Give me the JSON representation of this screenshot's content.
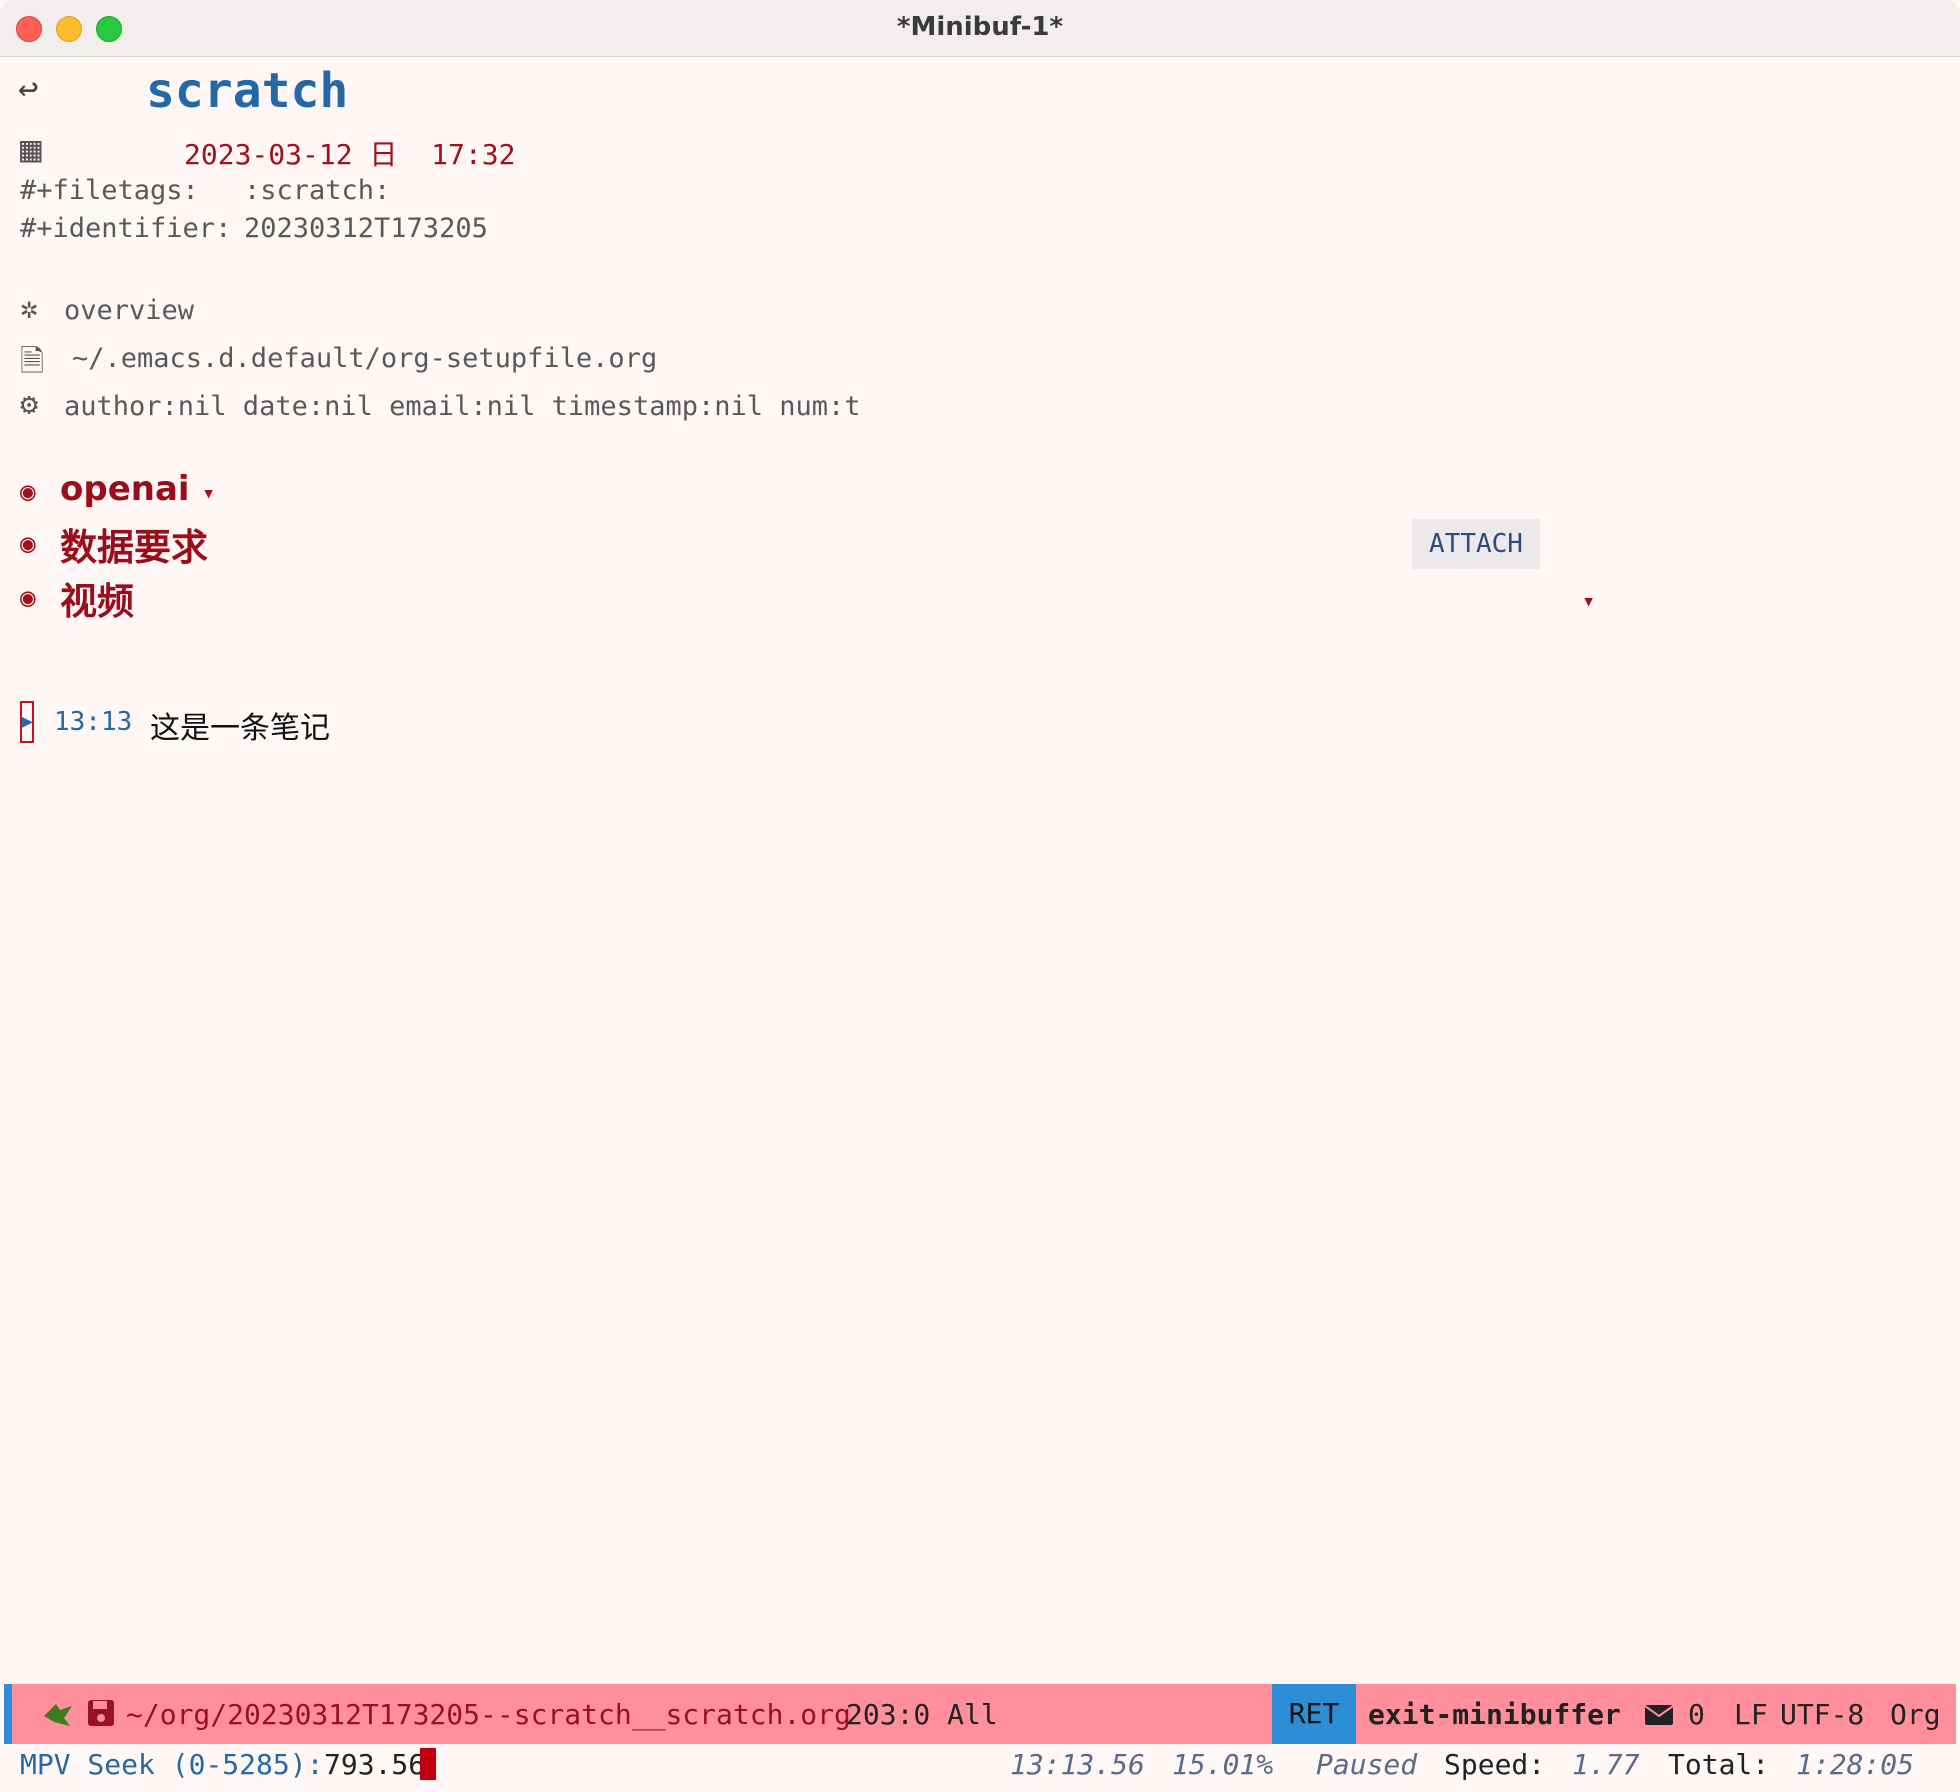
{
  "window": {
    "title": "*Minibuf-1*"
  },
  "buffer": {
    "title_icon": "↩",
    "title": "scratch",
    "calendar_icon": "▦",
    "date": "2023-03-12 日  17:32",
    "filetags_key": "#+filetags:",
    "filetags_value": ":scratch:",
    "identifier_key": "#+identifier:",
    "identifier_value": "20230312T173205",
    "meta": [
      {
        "icon": "✲",
        "text": "overview"
      },
      {
        "icon": "🗎",
        "text": "~/.emacs.d.default/org-setupfile.org"
      },
      {
        "icon": "⚙",
        "text": "author:nil date:nil email:nil timestamp:nil num:t"
      }
    ],
    "headings": [
      {
        "bullet": "◉",
        "text": "openai",
        "fold": "▾"
      },
      {
        "bullet": "◉",
        "text": "数据要求"
      },
      {
        "bullet": "◉",
        "text": "视频"
      }
    ],
    "attach_label": "ATTACH",
    "attach_fold": "▾",
    "note": {
      "marker": "▶",
      "time": "13:13",
      "text": "这是一条笔记"
    }
  },
  "modeline": {
    "file": "~/org/20230312T173205--scratch__scratch.org",
    "position": "203:0 All",
    "key": "RET",
    "command": "exit-minibuffer",
    "mail_count": "0",
    "eol": "LF",
    "encoding": "UTF-8",
    "mode": "Org"
  },
  "minibuffer": {
    "prompt": "MPV Seek (0-5285):",
    "input": "793.56",
    "time": "13:13.56",
    "percent": "15.01%",
    "state": "Paused",
    "speed_label": "Speed:",
    "speed": "1.77",
    "total_label": "Total:",
    "total": "1:28:05"
  }
}
